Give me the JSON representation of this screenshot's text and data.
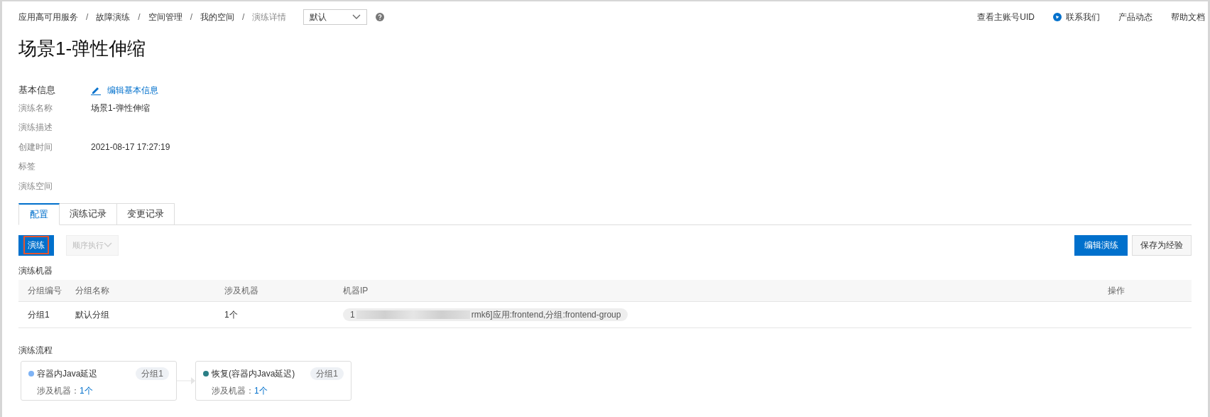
{
  "breadcrumb": [
    {
      "label": "应用高可用服务",
      "current": false
    },
    {
      "separator": "/",
      "label": "故障演练",
      "current": false
    },
    {
      "separator": "/",
      "label": "空间管理",
      "current": false
    },
    {
      "separator": "/",
      "label": "我的空间",
      "current": false
    },
    {
      "separator": "/",
      "label": "演练详情",
      "current": true
    }
  ],
  "space_select": {
    "value": "默认"
  },
  "top_links": [
    {
      "label": "查看主账号UID",
      "kind": "text"
    },
    {
      "label": "联系我们",
      "kind": "icon"
    },
    {
      "label": "产品动态",
      "kind": "text"
    },
    {
      "label": "帮助文档",
      "kind": "text"
    }
  ],
  "title": "场景1-弹性伸缩",
  "basic_info": {
    "heading": "基本信息",
    "edit_link": "编辑基本信息",
    "fields": [
      {
        "label": "演练名称",
        "value": "场景1-弹性伸缩"
      },
      {
        "label": "演练描述"
      },
      {
        "label": "创建时间",
        "value": "2021-08-17 17:27:19"
      },
      {
        "label": "标签"
      },
      {
        "label": "演练空间"
      }
    ]
  },
  "tabs": [
    {
      "label": "配置",
      "selected": true
    },
    {
      "label": "演练记录",
      "selected": false
    },
    {
      "label": "变更记录",
      "selected": false
    }
  ],
  "toolbar": {
    "run_button": "演练",
    "mode_select": {
      "value": "顺序执行",
      "disabled": true
    },
    "edit_button": "编辑演练",
    "save_button": "保存为经验"
  },
  "machines": {
    "heading": "演练机器",
    "columns": [
      "分组编号",
      "分组名称",
      "涉及机器",
      "机器IP",
      "操作"
    ],
    "rows": [
      {
        "group_no": "分组1",
        "group_name": "默认分组",
        "machines": "1个",
        "ip_start": "1",
        "ip_end": "rmk6]应用:frontend,分组:frontend-group"
      }
    ]
  },
  "flow": {
    "heading": "演练流程",
    "steps": [
      {
        "name": "容器内Java延迟",
        "color": "#7eb3f5",
        "group": "分组1",
        "machines_label": "涉及机器：",
        "machines": "1个"
      },
      {
        "name": "恢复(容器内Java延迟)",
        "color": "#2b7f86",
        "group": "分组1",
        "machines_label": "涉及机器：",
        "machines": "1个"
      }
    ]
  }
}
